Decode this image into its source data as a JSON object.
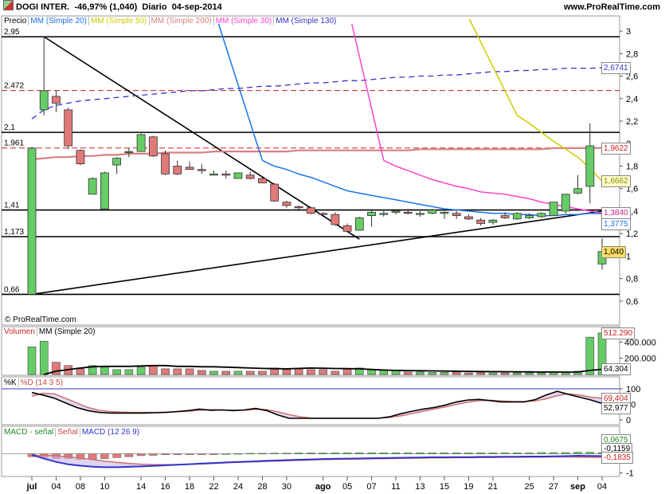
{
  "header": {
    "symbol": "DOGI INTER.",
    "change": "-46,97% (1,040)",
    "period": "Diario",
    "date": "04-sep-2014",
    "site": "www.ProRealTime.com",
    "watermark": "© ProRealTime.com"
  },
  "colors": {
    "up": "#66cc66",
    "down": "#e07a7a",
    "ma20": "#1a73e8",
    "ma50": "#cccc00",
    "ma200": "#d98080",
    "ma30": "#ff44cc",
    "ma130": "#3333cc",
    "macd_line": "#3333cc",
    "signal_line": "#d07070"
  },
  "chart_data": [
    {
      "type": "candlestick",
      "legend": [
        "Precio",
        "MM (Simple 20)",
        "MM (Simple 50)",
        "MM (Simple 200)",
        "MM (Simple 30)",
        "MM (Simple 130)"
      ],
      "x_ticks": [
        "jul",
        "04",
        "08",
        "10",
        "14",
        "16",
        "18",
        "22",
        "24",
        "28",
        "30",
        "ago",
        "05",
        "07",
        "11",
        "13",
        "15",
        "19",
        "21",
        "25",
        "27",
        "sep",
        "04"
      ],
      "y_ticks": [
        "3",
        "2,8",
        "2,6",
        "2,4",
        "2,2",
        "2",
        "1,8",
        "1,6",
        "1,4",
        "1,2",
        "1",
        "0,8",
        "0,6"
      ],
      "ylim": [
        0.5,
        3.05
      ],
      "horizontal_levels": [
        {
          "value": 2.95,
          "label": "2,95"
        },
        {
          "value": 2.472,
          "label": "2,472",
          "style": "dashed"
        },
        {
          "value": 2.1,
          "label": "2,1"
        },
        {
          "value": 1.961,
          "label": "1,961",
          "style": "dashed"
        },
        {
          "value": 1.41,
          "label": "1,41"
        },
        {
          "value": 1.173,
          "label": "1,173"
        },
        {
          "value": 0.66,
          "label": "0,66"
        }
      ],
      "candles": [
        [
          0.66,
          1.97,
          0.66,
          1.96
        ],
        [
          2.3,
          2.95,
          2.25,
          2.47
        ],
        [
          2.42,
          2.47,
          2.28,
          2.36
        ],
        [
          2.3,
          2.32,
          1.95,
          1.98
        ],
        [
          1.94,
          1.95,
          1.81,
          1.82
        ],
        [
          1.55,
          1.7,
          1.55,
          1.69
        ],
        [
          1.42,
          1.75,
          1.42,
          1.74
        ],
        [
          1.81,
          1.88,
          1.73,
          1.87
        ],
        [
          1.92,
          1.96,
          1.88,
          1.93
        ],
        [
          1.93,
          2.09,
          1.93,
          2.08
        ],
        [
          2.06,
          2.07,
          1.88,
          1.89
        ],
        [
          1.91,
          1.94,
          1.72,
          1.73
        ],
        [
          1.8,
          1.85,
          1.72,
          1.73
        ],
        [
          1.79,
          1.84,
          1.77,
          1.77
        ],
        [
          1.77,
          1.82,
          1.73,
          1.76
        ],
        [
          1.73,
          1.76,
          1.72,
          1.73
        ],
        [
          1.73,
          1.76,
          1.69,
          1.72
        ],
        [
          1.69,
          1.74,
          1.69,
          1.74
        ],
        [
          1.72,
          1.75,
          1.68,
          1.69
        ],
        [
          1.69,
          1.7,
          1.65,
          1.65
        ],
        [
          1.64,
          1.65,
          1.48,
          1.49
        ],
        [
          1.48,
          1.49,
          1.43,
          1.45
        ],
        [
          1.44,
          1.45,
          1.4,
          1.43
        ],
        [
          1.43,
          1.44,
          1.37,
          1.38
        ],
        [
          1.38,
          1.39,
          1.35,
          1.37
        ],
        [
          1.37,
          1.39,
          1.27,
          1.28
        ],
        [
          1.27,
          1.29,
          1.21,
          1.22
        ],
        [
          1.23,
          1.35,
          1.23,
          1.34
        ],
        [
          1.36,
          1.41,
          1.26,
          1.39
        ],
        [
          1.37,
          1.41,
          1.35,
          1.38
        ],
        [
          1.39,
          1.41,
          1.37,
          1.4
        ],
        [
          1.39,
          1.42,
          1.37,
          1.38
        ],
        [
          1.38,
          1.4,
          1.35,
          1.38
        ],
        [
          1.38,
          1.42,
          1.37,
          1.41
        ],
        [
          1.38,
          1.4,
          1.33,
          1.39
        ],
        [
          1.38,
          1.4,
          1.33,
          1.36
        ],
        [
          1.35,
          1.37,
          1.32,
          1.33
        ],
        [
          1.32,
          1.34,
          1.27,
          1.29
        ],
        [
          1.3,
          1.33,
          1.28,
          1.32
        ],
        [
          1.36,
          1.39,
          1.33,
          1.34
        ],
        [
          1.33,
          1.39,
          1.32,
          1.38
        ],
        [
          1.34,
          1.38,
          1.33,
          1.36
        ],
        [
          1.35,
          1.39,
          1.34,
          1.38
        ],
        [
          1.36,
          1.48,
          1.36,
          1.48
        ],
        [
          1.4,
          1.52,
          1.38,
          1.55
        ],
        [
          1.56,
          1.72,
          1.55,
          1.6
        ],
        [
          1.62,
          2.18,
          1.47,
          1.98
        ],
        [
          0.93,
          1.16,
          0.88,
          1.04
        ]
      ],
      "ma20": [
        null,
        null,
        null,
        null,
        null,
        null,
        null,
        null,
        null,
        null,
        null,
        null,
        null,
        null,
        null,
        null,
        null,
        null,
        null,
        1.85,
        1.8,
        1.77,
        1.73,
        1.7,
        1.66,
        1.62,
        1.58,
        1.56,
        1.54,
        1.52,
        1.5,
        1.48,
        1.46,
        1.44,
        1.42,
        1.41,
        1.4,
        1.39,
        1.38,
        1.38,
        1.37,
        1.37,
        1.36,
        1.36,
        1.37,
        1.37,
        1.38,
        1.3775
      ],
      "ma30": [
        null,
        null,
        null,
        null,
        null,
        null,
        null,
        null,
        null,
        null,
        null,
        null,
        null,
        null,
        null,
        null,
        null,
        null,
        null,
        null,
        null,
        null,
        null,
        null,
        null,
        null,
        null,
        null,
        null,
        1.85,
        1.8,
        1.76,
        1.72,
        1.68,
        1.65,
        1.62,
        1.6,
        1.57,
        1.56,
        1.55,
        1.53,
        1.51,
        1.48,
        1.46,
        1.44,
        1.42,
        1.4,
        1.384
      ],
      "ma50": [
        null,
        null,
        null,
        null,
        null,
        null,
        null,
        null,
        null,
        null,
        null,
        null,
        null,
        null,
        null,
        null,
        null,
        null,
        null,
        null,
        null,
        null,
        null,
        null,
        null,
        null,
        null,
        null,
        null,
        null,
        null,
        null,
        null,
        null,
        null,
        null,
        null,
        null,
        null,
        null,
        2.25,
        2.18,
        2.1,
        2.02,
        1.95,
        1.88,
        1.78,
        1.6662
      ],
      "ma130": [
        2.22,
        2.3,
        2.34,
        2.36,
        2.38,
        2.39,
        2.4,
        2.41,
        2.42,
        2.43,
        2.44,
        2.45,
        2.46,
        2.47,
        2.47,
        2.48,
        2.49,
        2.49,
        2.5,
        2.51,
        2.51,
        2.52,
        2.53,
        2.54,
        2.54,
        2.55,
        2.56,
        2.56,
        2.57,
        2.58,
        2.59,
        2.59,
        2.6,
        2.6,
        2.61,
        2.61,
        2.62,
        2.63,
        2.64,
        2.64,
        2.65,
        2.65,
        2.66,
        2.66,
        2.67,
        2.67,
        2.67,
        2.6741
      ],
      "ma200": [
        1.86,
        1.87,
        1.88,
        1.88,
        1.89,
        1.89,
        1.9,
        1.9,
        1.91,
        1.91,
        1.91,
        1.92,
        1.92,
        1.92,
        1.92,
        1.93,
        1.93,
        1.93,
        1.93,
        1.93,
        1.93,
        1.93,
        1.94,
        1.94,
        1.94,
        1.94,
        1.94,
        1.94,
        1.94,
        1.94,
        1.94,
        1.94,
        1.95,
        1.95,
        1.95,
        1.95,
        1.95,
        1.95,
        1.95,
        1.95,
        1.95,
        1.95,
        1.95,
        1.96,
        1.96,
        1.96,
        1.96,
        1.9622
      ],
      "value_tags": [
        {
          "value": 2.6741,
          "label": "2,6741",
          "series": "ma130"
        },
        {
          "value": 1.9622,
          "label": "1,9622",
          "series": "ma200"
        },
        {
          "value": 1.6662,
          "label": "1,6662",
          "series": "ma50"
        },
        {
          "value": 1.384,
          "label": "1,3840",
          "series": "ma30"
        },
        {
          "value": 1.3775,
          "label": "1,3775",
          "series": "ma20"
        },
        {
          "value": 1.04,
          "label": "1,040",
          "series": "price"
        }
      ]
    },
    {
      "type": "bar",
      "legend": [
        "Volumen",
        "MM (Simple 20)"
      ],
      "y_ticks": [
        "400.000",
        "200.000"
      ],
      "ylim": [
        0,
        560000
      ],
      "values": [
        340000,
        410000,
        150000,
        110000,
        70000,
        110000,
        90000,
        60000,
        60000,
        90000,
        110000,
        70000,
        70000,
        70000,
        50000,
        40000,
        40000,
        40000,
        40000,
        40000,
        80000,
        60000,
        70000,
        60000,
        60000,
        40000,
        70000,
        80000,
        60000,
        50000,
        50000,
        30000,
        30000,
        25000,
        25000,
        30000,
        20000,
        25000,
        20000,
        20000,
        20000,
        20000,
        20000,
        30000,
        30000,
        40000,
        460000,
        512290
      ],
      "ma": [
        null,
        0,
        40000,
        60000,
        80000,
        95000,
        100000,
        100000,
        100000,
        105000,
        110000,
        110000,
        100000,
        100000,
        95000,
        95000,
        90000,
        85000,
        80000,
        75000,
        72000,
        70000,
        75000,
        80000,
        78000,
        74000,
        72000,
        70000,
        62000,
        55000,
        50000,
        48000,
        46000,
        44000,
        42000,
        40000,
        38000,
        36000,
        35000,
        34000,
        33000,
        32000,
        30000,
        30000,
        29000,
        30000,
        50000,
        64304
      ],
      "value_tags": [
        {
          "value": 512290,
          "label": "512.290"
        },
        {
          "value": 64304,
          "label": "64.304"
        }
      ]
    },
    {
      "type": "line",
      "legend": [
        "%K",
        "%D (14 3 5)"
      ],
      "y_ticks": [
        "100",
        "50",
        "0"
      ],
      "ylim": [
        0,
        100
      ],
      "k": [
        88,
        80,
        70,
        55,
        40,
        30,
        24,
        22,
        22,
        22,
        22,
        23,
        24,
        27,
        30,
        35,
        31,
        32,
        30,
        32,
        37,
        30,
        16,
        5,
        5,
        5,
        5,
        5,
        5,
        5,
        5,
        5,
        10,
        20,
        28,
        35,
        40,
        48,
        58,
        64,
        66,
        62,
        58,
        58,
        58,
        65,
        80,
        92,
        82,
        73,
        64,
        52.977
      ],
      "d": [
        76,
        86,
        84,
        70,
        55,
        40,
        31,
        27,
        25,
        24,
        24,
        24,
        25,
        26,
        28,
        31,
        33,
        32,
        31,
        31,
        34,
        33,
        26,
        17,
        10,
        6,
        5,
        5,
        5,
        5,
        5,
        6,
        8,
        13,
        20,
        28,
        35,
        42,
        50,
        57,
        62,
        63,
        61,
        59,
        59,
        61,
        68,
        78,
        84,
        80,
        73,
        69.404
      ],
      "value_tags": [
        {
          "value": 69.404,
          "label": "69,404"
        },
        {
          "value": 52.977,
          "label": "52,977"
        }
      ]
    },
    {
      "type": "bar",
      "legend": [
        "MACD - señal",
        "Señal",
        "MACD (12 26 9)"
      ],
      "y_ticks": [
        "-1"
      ],
      "ylim": [
        -1.1,
        0.9
      ],
      "histogram": [
        -0.15,
        -0.2,
        -0.25,
        -0.25,
        -0.3,
        -0.3,
        -0.25,
        -0.2,
        -0.15,
        -0.1,
        -0.08,
        -0.05,
        -0.04,
        -0.03,
        -0.02,
        -0.01,
        0.01,
        0.02,
        0.03,
        0.03,
        0.04,
        0.04,
        0.05,
        0.05,
        0.05,
        0.06,
        0.06,
        0.06,
        0.06,
        0.06,
        0.06,
        0.06,
        0.06,
        0.06,
        0.06,
        0.06,
        0.06,
        0.06,
        0.06,
        0.06,
        0.06,
        0.06,
        0.07,
        0.07,
        0.07,
        0.09,
        0.09,
        0.0675
      ],
      "macd": [
        -0.05,
        -0.25,
        -0.42,
        -0.55,
        -0.62,
        -0.67,
        -0.7,
        -0.7,
        -0.68,
        -0.66,
        -0.63,
        -0.6,
        -0.57,
        -0.54,
        -0.51,
        -0.48,
        -0.45,
        -0.42,
        -0.4,
        -0.37,
        -0.35,
        -0.33,
        -0.31,
        -0.29,
        -0.27,
        -0.26,
        -0.25,
        -0.24,
        -0.23,
        -0.22,
        -0.21,
        -0.2,
        -0.19,
        -0.18,
        -0.18,
        -0.17,
        -0.17,
        -0.16,
        -0.16,
        -0.15,
        -0.15,
        -0.14,
        -0.14,
        -0.13,
        -0.12,
        -0.1,
        -0.11,
        -0.1159
      ],
      "signal": [
        -0.1,
        -0.08,
        -0.1,
        -0.16,
        -0.22,
        -0.3,
        -0.38,
        -0.44,
        -0.5,
        -0.54,
        -0.56,
        -0.57,
        -0.56,
        -0.55,
        -0.53,
        -0.5,
        -0.47,
        -0.44,
        -0.42,
        -0.4,
        -0.38,
        -0.36,
        -0.34,
        -0.32,
        -0.3,
        -0.29,
        -0.28,
        -0.27,
        -0.26,
        -0.25,
        -0.24,
        -0.23,
        -0.22,
        -0.21,
        -0.21,
        -0.2,
        -0.2,
        -0.19,
        -0.19,
        -0.18,
        -0.18,
        -0.17,
        -0.17,
        -0.16,
        -0.16,
        -0.17,
        -0.18,
        -0.1835
      ],
      "value_tags": [
        {
          "value": 0.0675,
          "label": "0,0675"
        },
        {
          "value": -0.1159,
          "label": "-0,1159"
        },
        {
          "value": -0.1835,
          "label": "-0,1835"
        }
      ]
    }
  ]
}
